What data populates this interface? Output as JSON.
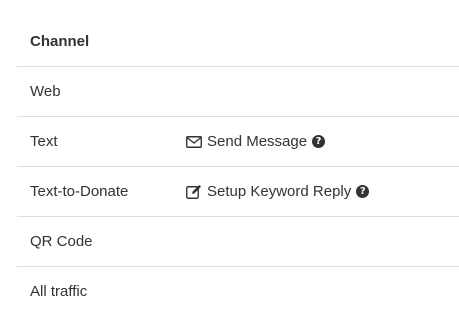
{
  "table": {
    "header": "Channel",
    "rows": [
      {
        "name": "Web",
        "action": null
      },
      {
        "name": "Text",
        "action": {
          "label": "Send Message",
          "icon": "envelope-icon"
        }
      },
      {
        "name": "Text-to-Donate",
        "action": {
          "label": "Setup Keyword Reply",
          "icon": "edit-icon"
        }
      },
      {
        "name": "QR Code",
        "action": null
      },
      {
        "name": "All traffic",
        "action": null
      }
    ]
  },
  "help_glyph": "?"
}
